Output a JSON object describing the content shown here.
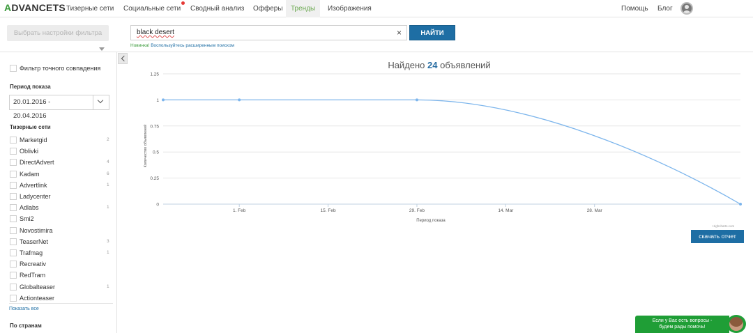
{
  "app": {
    "logo_accent": "A",
    "logo_rest": "DVANCETS"
  },
  "nav": {
    "items": [
      {
        "label": "Тизерные сети"
      },
      {
        "label": "Социальные сети"
      },
      {
        "label": "Сводный анализ"
      },
      {
        "label": "Офферы"
      },
      {
        "label": "Тренды"
      },
      {
        "label": "Изображения"
      }
    ],
    "active": "Тренды",
    "help": "Помощь",
    "blog": "Блог"
  },
  "search": {
    "filter_button": "Выбрать настройки фильтра",
    "value": "black desert",
    "clear_icon": "×",
    "submit": "НАЙТИ",
    "promo_new": "Новинка!",
    "promo_link": "Воспользуйтесь расширенным поиском"
  },
  "sidebar": {
    "exact_match": "Фильтр точного совпадения",
    "period_title": "Период показа",
    "date_from": "20.01.2016 -",
    "date_to": "20.04.2016",
    "networks_title": "Тизерные сети",
    "networks": [
      {
        "name": "Marketgid",
        "count": "2"
      },
      {
        "name": "Oblivki",
        "count": ""
      },
      {
        "name": "DirectAdvert",
        "count": "4"
      },
      {
        "name": "Kadam",
        "count": "6"
      },
      {
        "name": "Advertlink",
        "count": "1"
      },
      {
        "name": "Ladycenter",
        "count": ""
      },
      {
        "name": "Adlabs",
        "count": "1"
      },
      {
        "name": "Smi2",
        "count": ""
      },
      {
        "name": "Novostimira",
        "count": ""
      },
      {
        "name": "TeaserNet",
        "count": "3"
      },
      {
        "name": "Trafmag",
        "count": "1"
      },
      {
        "name": "Recreativ",
        "count": ""
      },
      {
        "name": "RedTram",
        "count": ""
      },
      {
        "name": "Globalteaser",
        "count": "1"
      },
      {
        "name": "Actionteaser",
        "count": ""
      }
    ],
    "show_all": "Показать все",
    "countries_title": "По странам"
  },
  "results": {
    "prefix": "Найдено",
    "count": "24",
    "suffix": "объявлений"
  },
  "chart_data": {
    "type": "line",
    "title": "",
    "xlabel": "Период показа",
    "ylabel": "Количество объявлений",
    "x_ticks": [
      "1. Feb",
      "15. Feb",
      "29. Feb",
      "14. Mar",
      "28. Mar"
    ],
    "y_ticks": [
      "0",
      "0.25",
      "0.5",
      "0.75",
      "1",
      "1.25"
    ],
    "ylim": [
      0,
      1.25
    ],
    "series": [
      {
        "x": [
          "2016-01-20",
          "2016-02-01",
          "2016-02-29",
          "2016-04-20"
        ],
        "y": [
          1,
          1,
          1,
          0
        ]
      }
    ],
    "line_color": "#7cb5ec",
    "grid": true,
    "credit": "Highcharts.com"
  },
  "download_button": "скачать отчет",
  "chat": {
    "line1": "Если у Вас есть вопросы -",
    "line2": "будем рады помочь!"
  }
}
